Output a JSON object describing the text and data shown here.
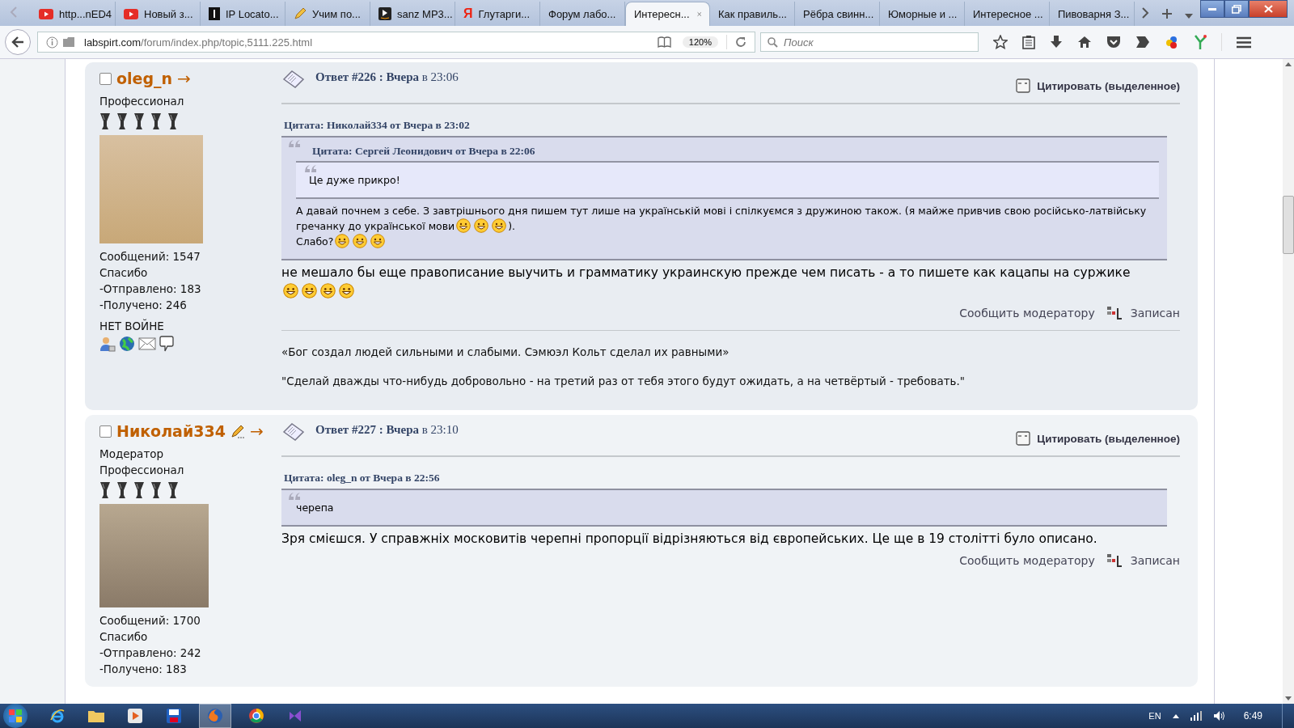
{
  "browser": {
    "tabs": [
      {
        "label": "http...nED4",
        "kind": "video",
        "selected": false
      },
      {
        "label": "Новый з...",
        "kind": "video",
        "selected": false
      },
      {
        "label": "IP Locato...",
        "kind": "dark",
        "selected": false
      },
      {
        "label": "Учим по...",
        "kind": "pencil",
        "selected": false
      },
      {
        "label": "sanz MP3...",
        "kind": "play",
        "selected": false
      },
      {
        "label": "Глутарги...",
        "kind": "letter",
        "icon_text": "Я",
        "selected": false
      },
      {
        "label": "Форум лабо...",
        "kind": "plain",
        "selected": false
      },
      {
        "label": "Интересн...",
        "kind": "plain",
        "selected": true
      },
      {
        "label": "Как правиль...",
        "kind": "plain",
        "selected": false
      },
      {
        "label": "Рёбра свинн...",
        "kind": "plain",
        "selected": false
      },
      {
        "label": "Юморные и ...",
        "kind": "plain",
        "selected": false
      },
      {
        "label": "Интересное ...",
        "kind": "plain",
        "selected": false
      },
      {
        "label": "Пивоварня З...",
        "kind": "plain",
        "selected": false
      }
    ],
    "url": {
      "domain": "labspirt.com",
      "path": "/forum/index.php/topic,5111.225.html"
    },
    "zoom": "120%",
    "search": {
      "placeholder": "Поиск"
    }
  },
  "posts": [
    {
      "author": {
        "name": "oleg_n",
        "arrow": "→",
        "checked": false,
        "moderator": false,
        "roles": [
          "Профессионал"
        ],
        "stars": 5,
        "stats": [
          "Сообщений: 1547",
          "Спасибо",
          "-Отправлено: 183",
          "-Получено: 246"
        ],
        "slogan": "НЕТ ВОЙНЕ",
        "contacts": true
      },
      "title": "**Ответ #226 : Вчера** в 23:06",
      "quote_button": "Цитировать (выделенное)",
      "quote": {
        "header": "Цитата: Николай334 от Вчера в 23:02",
        "inner": {
          "header": "Цитата: Сергей Леонидович от Вчера в 22:06",
          "paragraphs": [
            [
              {
                "kind": "text",
                "text": "Це дуже прикро!"
              }
            ]
          ]
        },
        "paragraphs": [
          [
            {
              "kind": "line",
              "text": "А давай почнем з себе. З завтрішнього дня пишем тут лише на українській мові і спілкуємся з дружиною також. (я майже привчив свою російсько-латвійську"
            },
            {
              "kind": "text",
              "text": "гречанку до української мови"
            },
            {
              "kind": "smiley"
            },
            {
              "kind": "smiley"
            },
            {
              "kind": "smiley"
            },
            {
              "kind": "text",
              "text": ")."
            }
          ],
          [
            {
              "kind": "text",
              "text": "Слабо?"
            },
            {
              "kind": "smiley"
            },
            {
              "kind": "smiley"
            },
            {
              "kind": "smiley"
            }
          ]
        ]
      },
      "body": [
        [
          {
            "kind": "line",
            "text": "не мешало бы  еще правописание  выучить и грамматику  украинскую прежде  чем писать  - а то пишете  как кацапы на  суржике"
          },
          {
            "kind": "smiley"
          },
          {
            "kind": "smiley"
          },
          {
            "kind": "smiley"
          },
          {
            "kind": "smiley"
          }
        ]
      ],
      "report": "Сообщить модератору",
      "status": "Записан",
      "signature": [
        "«Бог создал людей сильными и слабыми. Сэмюэл Кольт сделал их равными»",
        "\"Сделай дважды что-нибудь добровольно - на третий раз от тебя этого будут ожидать, а на четвёртый - требовать.\""
      ]
    },
    {
      "author": {
        "name": "Николай334",
        "arrow": "→",
        "checked": false,
        "moderator": true,
        "roles": [
          "Модератор",
          "Профессионал"
        ],
        "stars": 5,
        "stats": [
          "Сообщений: 1700",
          "Спасибо",
          "-Отправлено: 242",
          "-Получено: 183"
        ]
      },
      "title": "**Ответ #227 : Вчера** в 23:10",
      "quote_button": "Цитировать (выделенное)",
      "quote": {
        "header": "Цитата: oleg_n от Вчера в 22:56",
        "paragraphs": [
          [
            {
              "kind": "text",
              "text": "черепа"
            }
          ]
        ]
      },
      "body": [
        [
          {
            "kind": "text",
            "text": "Зря смієшся. У справжніх московитів черепні пропорції відрізняються від європейських. Це ще в 19 столітті було описано."
          }
        ]
      ],
      "report": "Сообщить модератору",
      "status": "Записан"
    }
  ],
  "taskbar": {
    "language": "EN",
    "time": "6:49"
  }
}
